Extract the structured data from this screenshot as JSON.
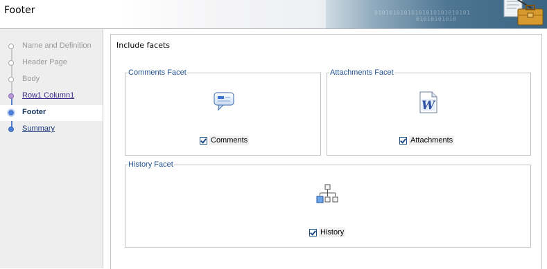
{
  "header": {
    "title": "Footer",
    "banner_bits_1": "01010101010101010101010101",
    "banner_bits_2": "01010101010"
  },
  "sidebar": {
    "steps": [
      {
        "label": "Name and Definition",
        "state": "disabled"
      },
      {
        "label": "Header Page",
        "state": "disabled"
      },
      {
        "label": "Body",
        "state": "disabled"
      },
      {
        "label": "Row1 Column1",
        "state": "visited"
      },
      {
        "label": "Footer",
        "state": "current"
      },
      {
        "label": "Summary",
        "state": "link"
      }
    ]
  },
  "main": {
    "title": "Include facets",
    "comments_facet": {
      "legend": "Comments Facet",
      "icon": "speech-bubble-icon",
      "checkbox_label": "Comments",
      "checked": true
    },
    "attachments_facet": {
      "legend": "Attachments Facet",
      "icon": "word-document-icon",
      "checkbox_label": "Attachments",
      "checked": true
    },
    "history_facet": {
      "legend": "History Facet",
      "icon": "hierarchy-tree-icon",
      "checkbox_label": "History",
      "checked": true
    }
  },
  "colors": {
    "legend_text": "#1f4f8f",
    "banner_blue": "#4e7693",
    "current_step": "#4d7fd6"
  }
}
